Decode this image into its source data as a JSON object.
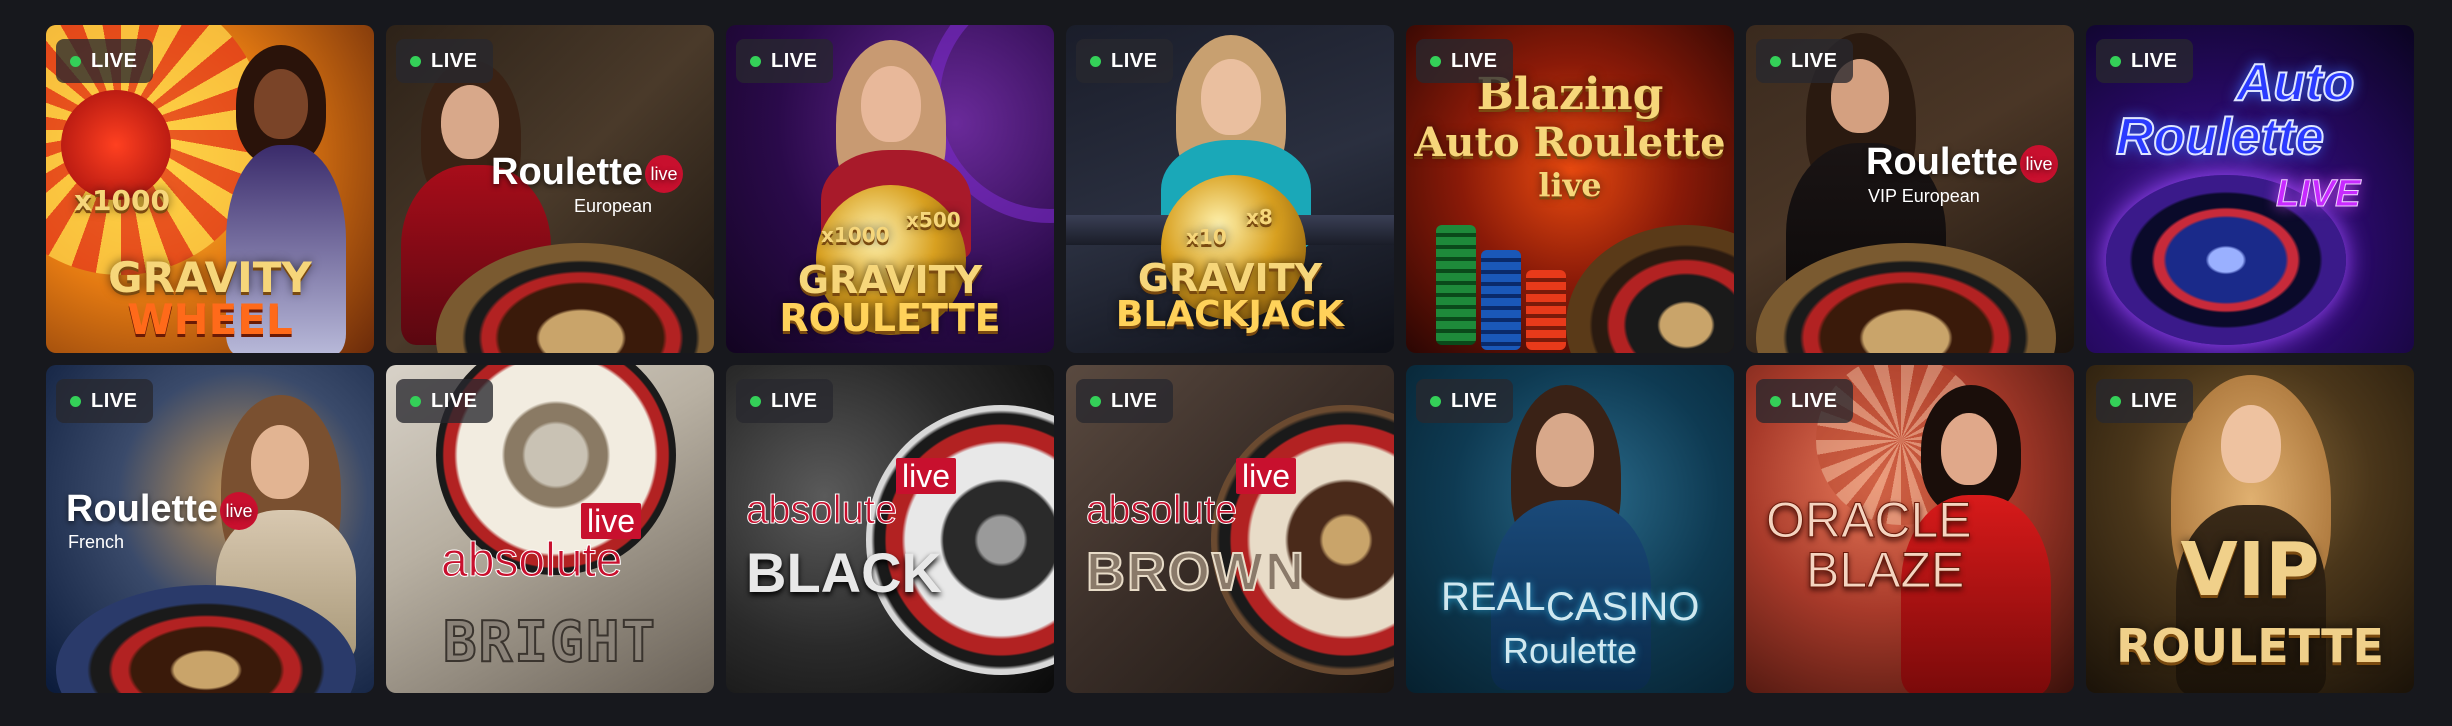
{
  "badge_label": "LIVE",
  "colors": {
    "live_dot": "#34d058",
    "badge_bg": "#28282e",
    "page_bg": "#17181d",
    "live_red": "#c8102e"
  },
  "games": [
    {
      "logo": [
        "GRAVITY",
        "WHEEL"
      ],
      "multiplier": "x1000"
    },
    {
      "logo": [
        "Roulette"
      ],
      "pill": "live",
      "sub": "European"
    },
    {
      "logo": [
        "GRAVITY",
        "ROULETTE"
      ],
      "multipliers": [
        "x1000",
        "x500"
      ]
    },
    {
      "logo": [
        "GRAVITY",
        "BLACKJACK"
      ],
      "multipliers": [
        "x10",
        "x8"
      ]
    },
    {
      "logo": [
        "Blazing",
        "Auto Roulette",
        "live"
      ]
    },
    {
      "logo": [
        "Roulette"
      ],
      "pill": "live",
      "sub": "VIP European"
    },
    {
      "logo": [
        "Auto",
        "Roulette",
        "LIVE"
      ]
    },
    {
      "logo": [
        "Roulette"
      ],
      "pill": "live",
      "sub": "French"
    },
    {
      "logo": [
        "live",
        "absolute",
        "BRIGHT"
      ]
    },
    {
      "logo": [
        "live",
        "absolute",
        "BLACK"
      ]
    },
    {
      "logo": [
        "live",
        "absolute",
        "BROWN"
      ]
    },
    {
      "logo": [
        "REAL",
        "CASINO",
        "Roulette"
      ]
    },
    {
      "logo": [
        "ORACLE",
        "BLAZE"
      ]
    },
    {
      "logo": [
        "VIP",
        "ROULETTE"
      ]
    }
  ]
}
